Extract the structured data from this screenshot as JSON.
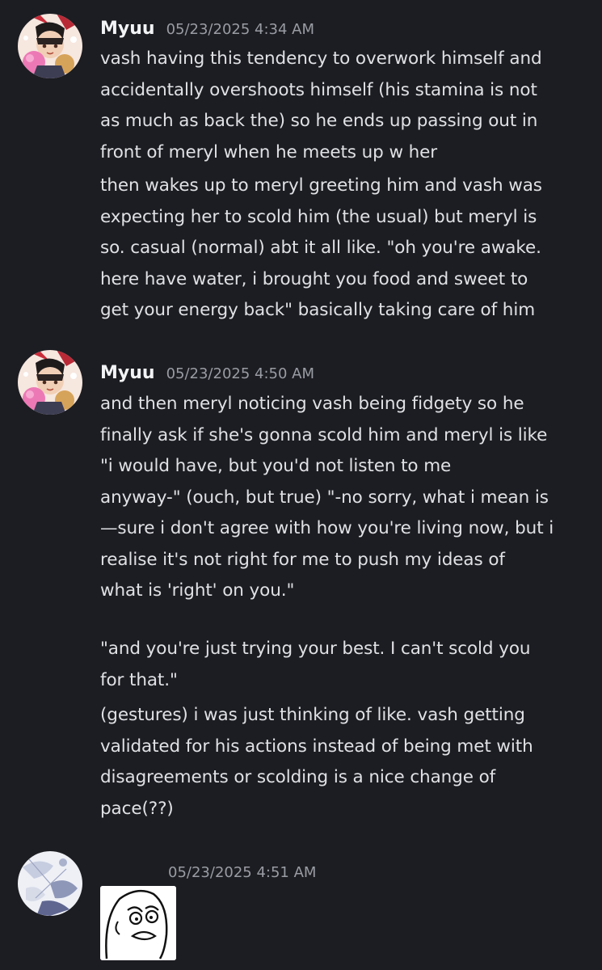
{
  "messages": [
    {
      "username": "Myuu",
      "timestamp": "05/23/2025 4:34 AM",
      "paragraphs": [
        "vash having this tendency to overwork himself and\naccidentally overshoots himself (his stamina is not\nas much as back the) so he ends up passing out in\nfront of meryl when he meets up w her",
        "then wakes up to meryl greeting him and vash was\nexpecting her to scold him (the usual) but meryl is\nso. casual (normal) abt it all like. \"oh you're awake.\nhere have water, i brought you food and sweet to\nget your energy back\" basically taking care of him"
      ]
    },
    {
      "username": "Myuu",
      "timestamp": "05/23/2025 4:50 AM",
      "paragraphs": [
        "and then meryl noticing vash being fidgety so he\nfinally ask if she's gonna scold him and meryl is like\n\"i would have, but you'd not listen to me\nanyway-\" (ouch, but true) \"-no sorry, what i mean is\n—sure i don't agree with how you're living now, but i\nrealise it's not right for me to push my ideas of\nwhat is 'right' on you.\"",
        "\"and you're just trying your best. I can't scold you\nfor that.\"",
        "(gestures) i was just thinking of like. vash getting\nvalidated for his actions instead of being met with\ndisagreements or scolding is a nice change of\npace(??)"
      ]
    },
    {
      "username": "",
      "timestamp": "05/23/2025 4:51 AM"
    }
  ]
}
